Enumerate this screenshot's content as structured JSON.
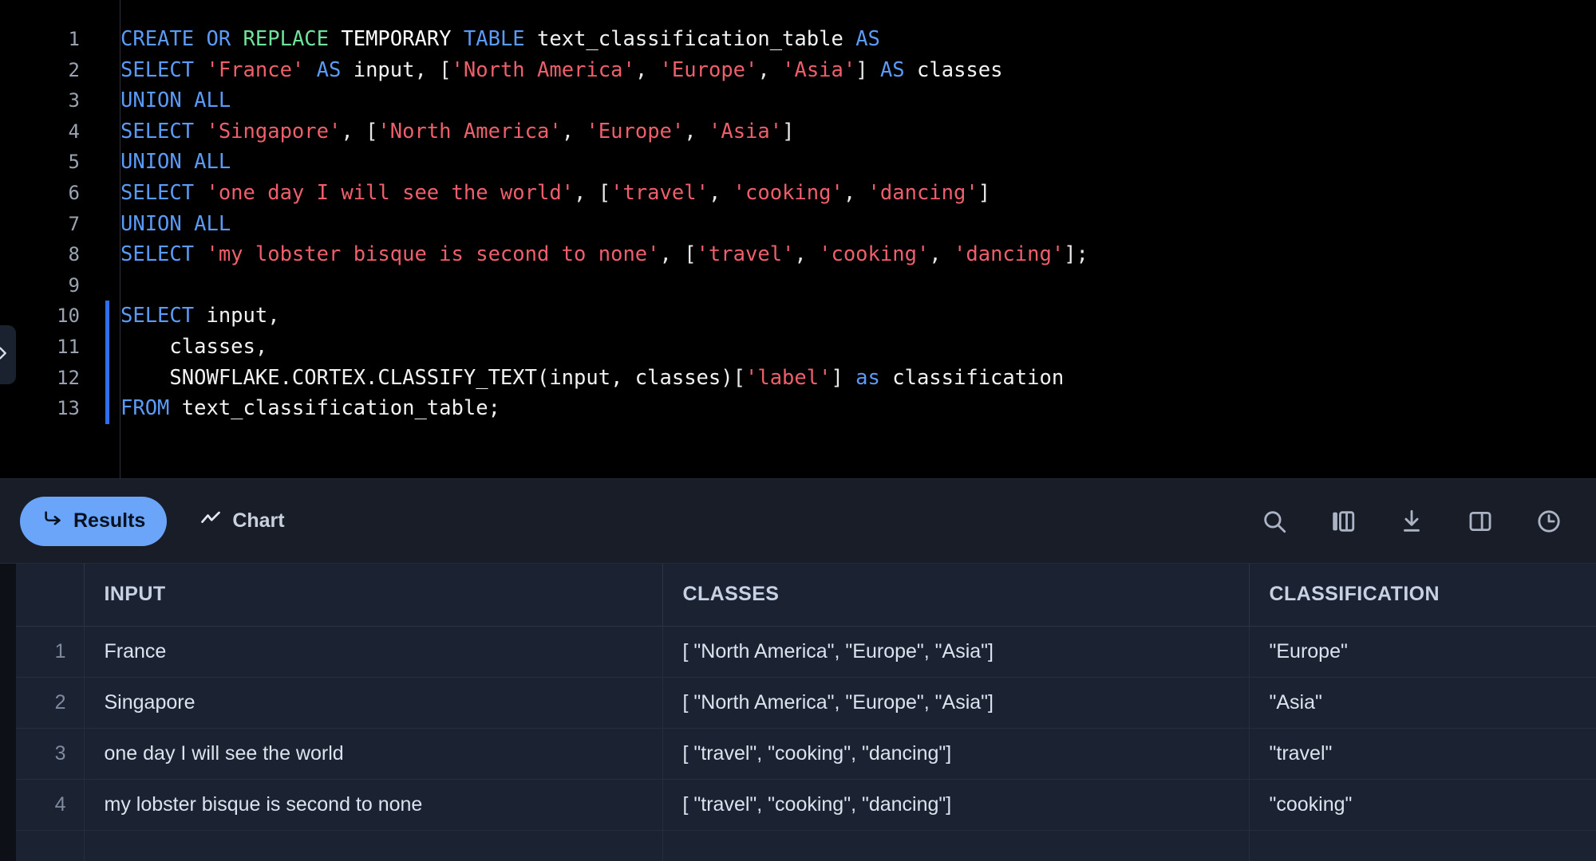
{
  "editor": {
    "language": "sql",
    "active_statement_lines": [
      10,
      11,
      12,
      13
    ],
    "expand_icon": "chevron-right-icon",
    "lines": [
      {
        "n": "1",
        "active": false,
        "tokens": [
          {
            "t": "CREATE ",
            "c": "kw"
          },
          {
            "t": "OR ",
            "c": "kw"
          },
          {
            "t": "REPLACE ",
            "c": "kw2"
          },
          {
            "t": "TEMPORARY ",
            "c": "kw3"
          },
          {
            "t": "TABLE ",
            "c": "kw"
          },
          {
            "t": "text_classification_table ",
            "c": "id"
          },
          {
            "t": "AS",
            "c": "kw"
          }
        ]
      },
      {
        "n": "2",
        "active": false,
        "tokens": [
          {
            "t": "SELECT ",
            "c": "kw"
          },
          {
            "t": "'France'",
            "c": "str"
          },
          {
            "t": " ",
            "c": "punc"
          },
          {
            "t": "AS ",
            "c": "kw"
          },
          {
            "t": "input",
            "c": "id"
          },
          {
            "t": ", [",
            "c": "punc"
          },
          {
            "t": "'North America'",
            "c": "str"
          },
          {
            "t": ", ",
            "c": "punc"
          },
          {
            "t": "'Europe'",
            "c": "str"
          },
          {
            "t": ", ",
            "c": "punc"
          },
          {
            "t": "'Asia'",
            "c": "str"
          },
          {
            "t": "] ",
            "c": "punc"
          },
          {
            "t": "AS ",
            "c": "kw"
          },
          {
            "t": "classes",
            "c": "id"
          }
        ]
      },
      {
        "n": "3",
        "active": false,
        "tokens": [
          {
            "t": "UNION ALL",
            "c": "kw"
          }
        ]
      },
      {
        "n": "4",
        "active": false,
        "tokens": [
          {
            "t": "SELECT ",
            "c": "kw"
          },
          {
            "t": "'Singapore'",
            "c": "str"
          },
          {
            "t": ", [",
            "c": "punc"
          },
          {
            "t": "'North America'",
            "c": "str"
          },
          {
            "t": ", ",
            "c": "punc"
          },
          {
            "t": "'Europe'",
            "c": "str"
          },
          {
            "t": ", ",
            "c": "punc"
          },
          {
            "t": "'Asia'",
            "c": "str"
          },
          {
            "t": "]",
            "c": "punc"
          }
        ]
      },
      {
        "n": "5",
        "active": false,
        "tokens": [
          {
            "t": "UNION ALL",
            "c": "kw"
          }
        ]
      },
      {
        "n": "6",
        "active": false,
        "tokens": [
          {
            "t": "SELECT ",
            "c": "kw"
          },
          {
            "t": "'one day I will see the world'",
            "c": "str"
          },
          {
            "t": ", [",
            "c": "punc"
          },
          {
            "t": "'travel'",
            "c": "str"
          },
          {
            "t": ", ",
            "c": "punc"
          },
          {
            "t": "'cooking'",
            "c": "str"
          },
          {
            "t": ", ",
            "c": "punc"
          },
          {
            "t": "'dancing'",
            "c": "str"
          },
          {
            "t": "]",
            "c": "punc"
          }
        ]
      },
      {
        "n": "7",
        "active": false,
        "tokens": [
          {
            "t": "UNION ALL",
            "c": "kw"
          }
        ]
      },
      {
        "n": "8",
        "active": false,
        "tokens": [
          {
            "t": "SELECT ",
            "c": "kw"
          },
          {
            "t": "'my lobster bisque is second to none'",
            "c": "str"
          },
          {
            "t": ", [",
            "c": "punc"
          },
          {
            "t": "'travel'",
            "c": "str"
          },
          {
            "t": ", ",
            "c": "punc"
          },
          {
            "t": "'cooking'",
            "c": "str"
          },
          {
            "t": ", ",
            "c": "punc"
          },
          {
            "t": "'dancing'",
            "c": "str"
          },
          {
            "t": "];",
            "c": "punc"
          }
        ]
      },
      {
        "n": "9",
        "active": false,
        "tokens": []
      },
      {
        "n": "10",
        "active": true,
        "tokens": [
          {
            "t": "SELECT ",
            "c": "kw"
          },
          {
            "t": "input",
            "c": "id"
          },
          {
            "t": ",",
            "c": "punc"
          }
        ]
      },
      {
        "n": "11",
        "active": true,
        "tokens": [
          {
            "t": "    classes",
            "c": "id"
          },
          {
            "t": ",",
            "c": "punc"
          }
        ]
      },
      {
        "n": "12",
        "active": true,
        "tokens": [
          {
            "t": "    SNOWFLAKE.CORTEX.CLASSIFY_TEXT(input, classes)",
            "c": "id"
          },
          {
            "t": "[",
            "c": "punc"
          },
          {
            "t": "'label'",
            "c": "str"
          },
          {
            "t": "] ",
            "c": "punc"
          },
          {
            "t": "as ",
            "c": "kw"
          },
          {
            "t": "classification",
            "c": "id"
          }
        ]
      },
      {
        "n": "13",
        "active": true,
        "tokens": [
          {
            "t": "FROM ",
            "c": "kw"
          },
          {
            "t": "text_classification_table;",
            "c": "id"
          }
        ]
      }
    ]
  },
  "toolbar": {
    "tabs": [
      {
        "label": "Results",
        "icon": "arrow-return-icon",
        "active": true
      },
      {
        "label": "Chart",
        "icon": "line-chart-icon",
        "active": false
      }
    ],
    "icons": [
      {
        "name": "search-icon",
        "title": "Search"
      },
      {
        "name": "columns-icon",
        "title": "Columns"
      },
      {
        "name": "download-icon",
        "title": "Download"
      },
      {
        "name": "split-panel-icon",
        "title": "Split panel"
      },
      {
        "name": "history-clock-icon",
        "title": "History"
      }
    ]
  },
  "results_table": {
    "columns": [
      "",
      "INPUT",
      "CLASSES",
      "CLASSIFICATION"
    ],
    "rows": [
      {
        "n": "1",
        "input": "France",
        "classes": "[ \"North America\", \"Europe\", \"Asia\"]",
        "classification": "\"Europe\""
      },
      {
        "n": "2",
        "input": "Singapore",
        "classes": "[ \"North America\", \"Europe\", \"Asia\"]",
        "classification": "\"Asia\""
      },
      {
        "n": "3",
        "input": "one day I will see the world",
        "classes": "[ \"travel\", \"cooking\", \"dancing\"]",
        "classification": "\"travel\""
      },
      {
        "n": "4",
        "input": "my lobster bisque is second to none",
        "classes": "[ \"travel\", \"cooking\", \"dancing\"]",
        "classification": "\"cooking\""
      }
    ]
  },
  "colors": {
    "editor_background": "#000000",
    "panel_background": "#181d27",
    "table_background": "#1b2231",
    "accent_blue": "#6aa5fa",
    "active_statement_bar": "#2f6fed",
    "keyword_blue": "#5b9bf8",
    "keyword_green": "#6fe39b",
    "string_red": "#ef5f6b"
  }
}
